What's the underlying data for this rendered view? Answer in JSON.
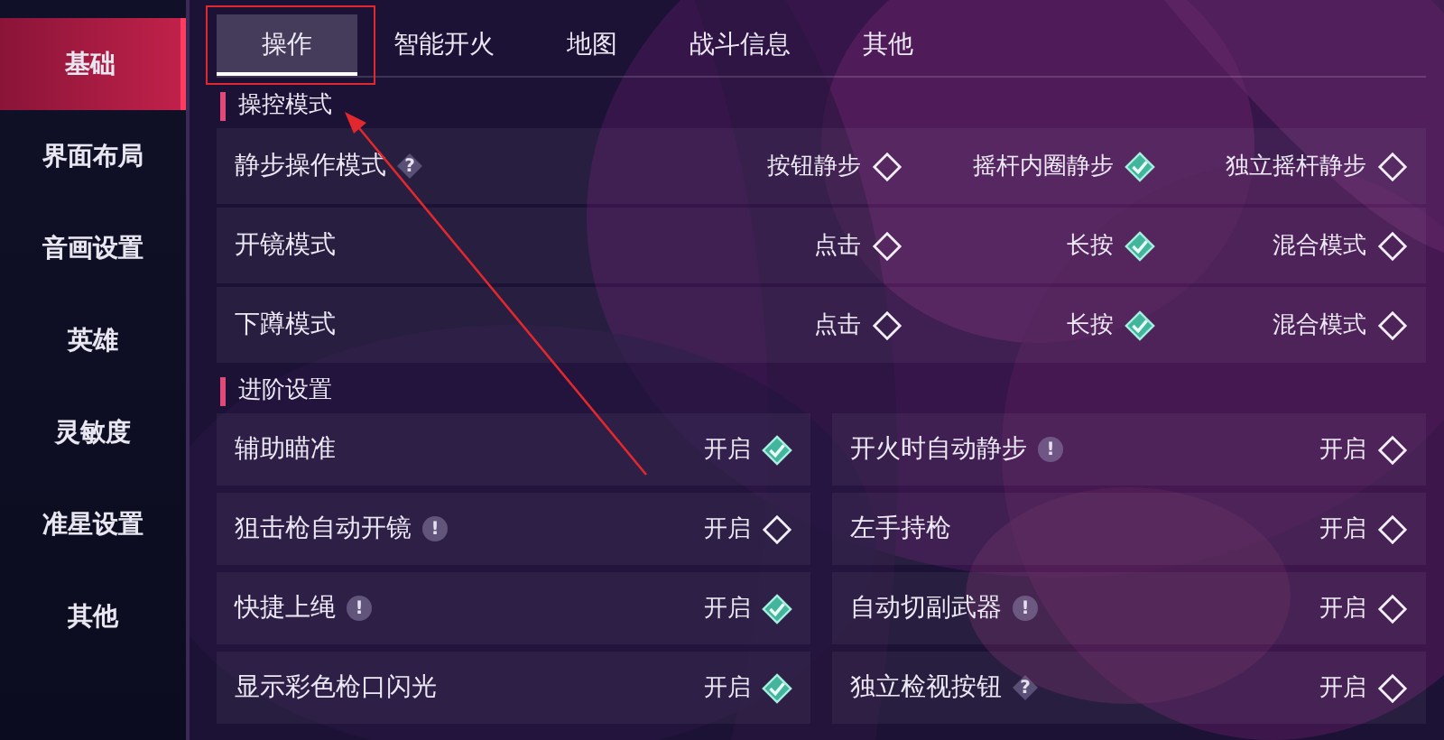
{
  "sidebar": {
    "items": [
      {
        "label": "基础",
        "selected": true
      },
      {
        "label": "界面布局",
        "selected": false
      },
      {
        "label": "音画设置",
        "selected": false
      },
      {
        "label": "英雄",
        "selected": false
      },
      {
        "label": "灵敏度",
        "selected": false
      },
      {
        "label": "准星设置",
        "selected": false
      },
      {
        "label": "其他",
        "selected": false
      }
    ]
  },
  "tabs": [
    {
      "label": "操作",
      "selected": true
    },
    {
      "label": "智能开火",
      "selected": false
    },
    {
      "label": "地图",
      "selected": false
    },
    {
      "label": "战斗信息",
      "selected": false
    },
    {
      "label": "其他",
      "selected": false
    }
  ],
  "sections": [
    {
      "title": "操控模式",
      "kind": "options",
      "rows": [
        {
          "label": "静步操作模式",
          "hint": {
            "kind": "help",
            "text": "?"
          },
          "options": [
            {
              "label": "按钮静步",
              "checked": false
            },
            {
              "label": "摇杆内圈静步",
              "checked": true
            },
            {
              "label": "独立摇杆静步",
              "checked": false
            }
          ]
        },
        {
          "label": "开镜模式",
          "options": [
            {
              "label": "点击",
              "checked": false
            },
            {
              "label": "长按",
              "checked": true
            },
            {
              "label": "混合模式",
              "checked": false
            }
          ]
        },
        {
          "label": "下蹲模式",
          "options": [
            {
              "label": "点击",
              "checked": false
            },
            {
              "label": "长按",
              "checked": true
            },
            {
              "label": "混合模式",
              "checked": false
            }
          ]
        }
      ]
    },
    {
      "title": "进阶设置",
      "kind": "toggles",
      "rows": [
        {
          "label": "辅助瞄准",
          "value": "开启",
          "checked": true
        },
        {
          "label": "开火时自动静步",
          "hint": {
            "kind": "warning",
            "text": "!"
          },
          "value": "开启",
          "checked": false
        },
        {
          "label": "狙击枪自动开镜",
          "hint": {
            "kind": "warning",
            "text": "!"
          },
          "value": "开启",
          "checked": false
        },
        {
          "label": "左手持枪",
          "value": "开启",
          "checked": false
        },
        {
          "label": "快捷上绳",
          "hint": {
            "kind": "warning",
            "text": "!"
          },
          "value": "开启",
          "checked": true
        },
        {
          "label": "自动切副武器",
          "hint": {
            "kind": "warning",
            "text": "!"
          },
          "value": "开启",
          "checked": false
        },
        {
          "label": "显示彩色枪口闪光",
          "value": "开启",
          "checked": true
        },
        {
          "label": "独立检视按钮",
          "hint": {
            "kind": "help",
            "text": "?"
          },
          "value": "开启",
          "checked": false
        }
      ]
    }
  ]
}
